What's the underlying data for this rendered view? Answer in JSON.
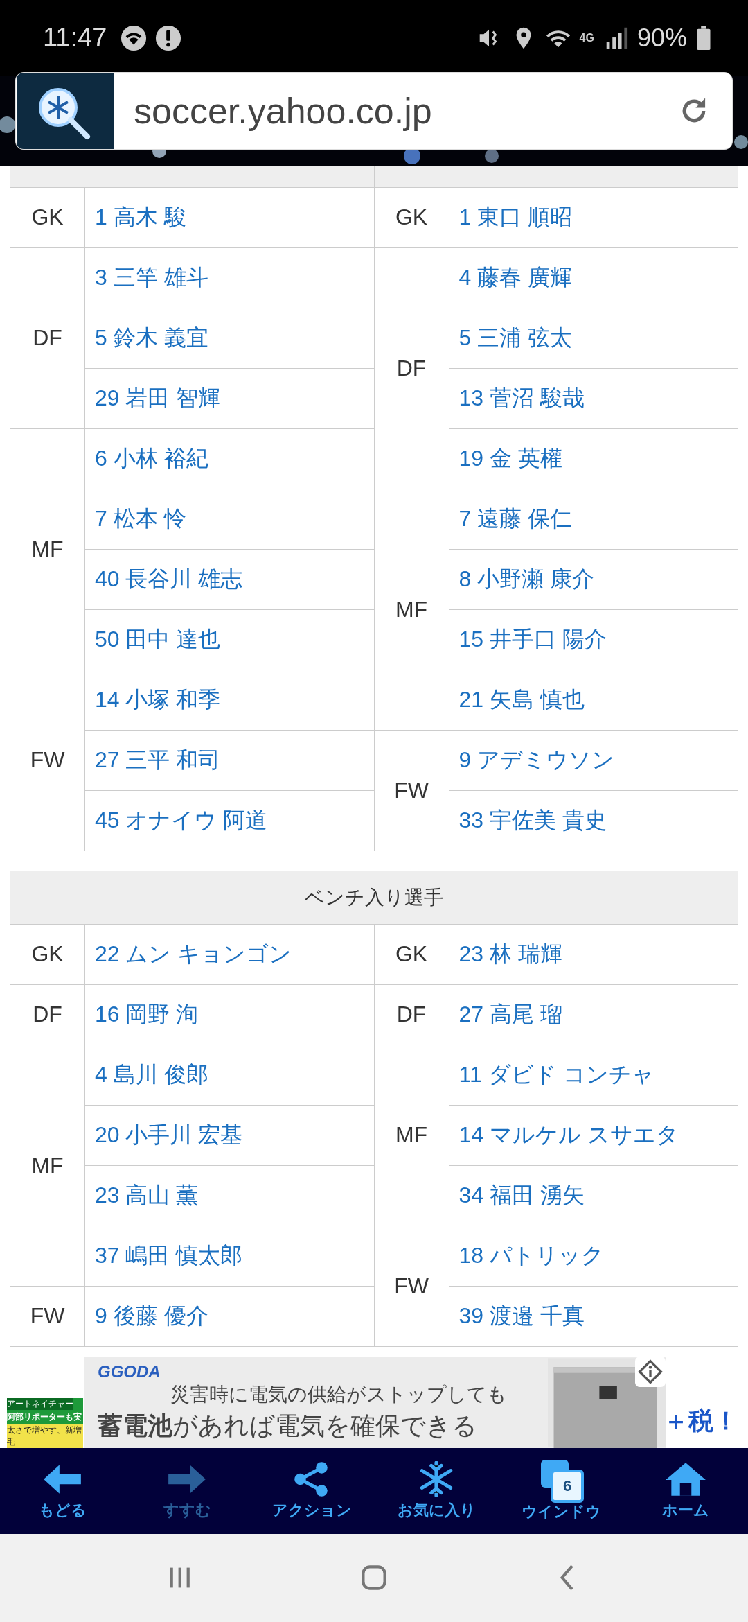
{
  "status_bar": {
    "time": "11:47",
    "network": "4G",
    "battery": "90%"
  },
  "browser": {
    "url": "soccer.yahoo.co.jp"
  },
  "starters": {
    "left": [
      {
        "position": "GK",
        "players": [
          "1 高木 駿"
        ]
      },
      {
        "position": "DF",
        "players": [
          "3 三竿 雄斗",
          "5 鈴木 義宜",
          "29 岩田 智輝"
        ]
      },
      {
        "position": "MF",
        "players": [
          "6 小林 裕紀",
          "7 松本 怜",
          "40 長谷川 雄志",
          "50 田中 達也"
        ]
      },
      {
        "position": "FW",
        "players": [
          "14 小塚 和季",
          "27 三平 和司",
          "45 オナイウ 阿道"
        ]
      }
    ],
    "right": [
      {
        "position": "GK",
        "players": [
          "1 東口 順昭"
        ]
      },
      {
        "position": "DF",
        "players": [
          "4 藤春 廣輝",
          "5 三浦 弦太",
          "13 菅沼 駿哉",
          "19 金 英權"
        ]
      },
      {
        "position": "MF",
        "players": [
          "7 遠藤 保仁",
          "8 小野瀬 康介",
          "15 井手口 陽介",
          "21 矢島 慎也"
        ]
      },
      {
        "position": "FW",
        "players": [
          "9 アデミウソン",
          "33 宇佐美 貴史"
        ]
      }
    ]
  },
  "bench": {
    "title": "ベンチ入り選手",
    "left": [
      {
        "position": "GK",
        "players": [
          "22 ムン キョンゴン"
        ]
      },
      {
        "position": "DF",
        "players": [
          "16 岡野 洵"
        ]
      },
      {
        "position": "MF",
        "players": [
          "4 島川 俊郎",
          "20 小手川 宏基",
          "23 高山 薫",
          "37 嶋田 慎太郎"
        ]
      },
      {
        "position": "FW",
        "players": [
          "9 後藤 優介"
        ]
      }
    ],
    "right": [
      {
        "position": "GK",
        "players": [
          "23 林 瑞輝"
        ]
      },
      {
        "position": "DF",
        "players": [
          "27 高尾 瑠"
        ]
      },
      {
        "position": "MF",
        "players": [
          "11 ダビド コンチャ",
          "14 マルケル スサエタ",
          "34 福田 湧矢"
        ]
      },
      {
        "position": "FW",
        "players": [
          "18 パトリック",
          "39 渡邉 千真"
        ]
      }
    ]
  },
  "ads": {
    "banner": {
      "logo": "GGODA",
      "line1": "災害時に電気の供給がストップしても",
      "line2": "**蓄電池**があれば電気を確保できる"
    },
    "thumbnail": {
      "brand": "アートネイチャー",
      "headline": "阿部リポーターも実",
      "tagline": "太さで増やす、新増毛"
    },
    "side_text": "＋税！"
  },
  "toolbar": [
    {
      "kind": "back",
      "label": "もどる",
      "disabled": false
    },
    {
      "kind": "forward",
      "label": "すすむ",
      "disabled": true
    },
    {
      "kind": "share",
      "label": "アクション",
      "disabled": false
    },
    {
      "kind": "favorite",
      "label": "お気に入り",
      "disabled": false
    },
    {
      "kind": "windows",
      "label": "ウインドウ",
      "badge": "6",
      "disabled": false
    },
    {
      "kind": "home",
      "label": "ホーム",
      "disabled": false
    }
  ]
}
